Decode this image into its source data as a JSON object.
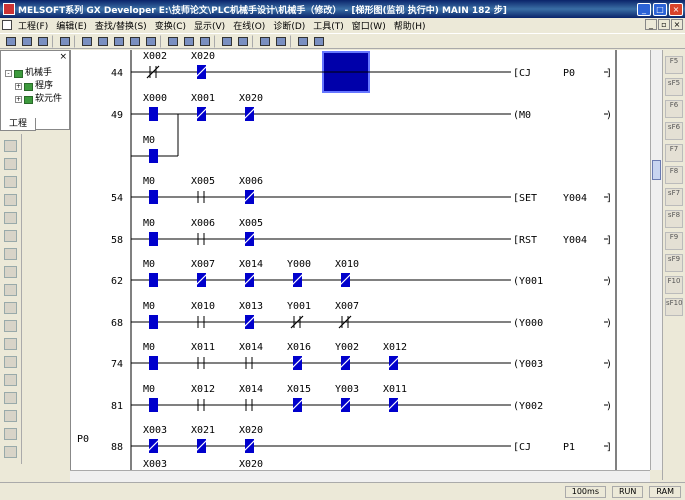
{
  "window": {
    "title": "MELSOFT系列 GX Developer E:\\技师论文\\PLC机械手设计\\机械手（修改） - [梯形图(监视 执行中)      MAIN    182 步]"
  },
  "menu": {
    "items": [
      "工程(F)",
      "编辑(E)",
      "查找/替换(S)",
      "变换(C)",
      "显示(V)",
      "在线(O)",
      "诊断(D)",
      "工具(T)",
      "窗口(W)",
      "帮助(H)"
    ]
  },
  "project_panel": {
    "root": "机械手",
    "children": [
      "程序",
      "软元件"
    ],
    "tab": "工程"
  },
  "ladder": {
    "rungs": [
      {
        "step": "44",
        "coil": "[CJ",
        "coil_arg": "P0",
        "contacts": [
          {
            "name": "X002",
            "type": "nc",
            "active": false
          },
          {
            "name": "X020",
            "type": "nc",
            "active": true
          }
        ]
      },
      {
        "step": "49",
        "coil": "(M0",
        "coil_arg": "",
        "contacts": [
          {
            "name": "X000",
            "type": "no",
            "active": true
          },
          {
            "name": "X001",
            "type": "nc",
            "active": true
          },
          {
            "name": "X020",
            "type": "nc",
            "active": true
          }
        ],
        "branch": {
          "name": "M0",
          "type": "no",
          "active": true
        }
      },
      {
        "step": "54",
        "coil": "[SET",
        "coil_arg": "Y004",
        "contacts": [
          {
            "name": "M0",
            "type": "no",
            "active": true
          },
          {
            "name": "X005",
            "type": "no",
            "active": false
          },
          {
            "name": "X006",
            "type": "nc",
            "active": true
          }
        ]
      },
      {
        "step": "58",
        "coil": "[RST",
        "coil_arg": "Y004",
        "contacts": [
          {
            "name": "M0",
            "type": "no",
            "active": true
          },
          {
            "name": "X006",
            "type": "no",
            "active": false
          },
          {
            "name": "X005",
            "type": "nc",
            "active": true
          }
        ]
      },
      {
        "step": "62",
        "coil": "(Y001",
        "coil_arg": "",
        "contacts": [
          {
            "name": "M0",
            "type": "no",
            "active": true
          },
          {
            "name": "X007",
            "type": "nc",
            "active": true
          },
          {
            "name": "X014",
            "type": "nc",
            "active": true
          },
          {
            "name": "Y000",
            "type": "nc",
            "active": true
          },
          {
            "name": "X010",
            "type": "nc",
            "active": true
          }
        ]
      },
      {
        "step": "68",
        "coil": "(Y000",
        "coil_arg": "",
        "contacts": [
          {
            "name": "M0",
            "type": "no",
            "active": true
          },
          {
            "name": "X010",
            "type": "no",
            "active": false
          },
          {
            "name": "X013",
            "type": "nc",
            "active": true
          },
          {
            "name": "Y001",
            "type": "nc",
            "active": false
          },
          {
            "name": "X007",
            "type": "nc",
            "active": false
          }
        ]
      },
      {
        "step": "74",
        "coil": "(Y003",
        "coil_arg": "",
        "contacts": [
          {
            "name": "M0",
            "type": "no",
            "active": true
          },
          {
            "name": "X011",
            "type": "no",
            "active": false
          },
          {
            "name": "X014",
            "type": "no",
            "active": false
          },
          {
            "name": "X016",
            "type": "nc",
            "active": true
          },
          {
            "name": "Y002",
            "type": "nc",
            "active": true
          },
          {
            "name": "X012",
            "type": "nc",
            "active": true
          }
        ]
      },
      {
        "step": "81",
        "coil": "(Y002",
        "coil_arg": "",
        "contacts": [
          {
            "name": "M0",
            "type": "no",
            "active": true
          },
          {
            "name": "X012",
            "type": "no",
            "active": false
          },
          {
            "name": "X014",
            "type": "no",
            "active": false
          },
          {
            "name": "X015",
            "type": "nc",
            "active": true
          },
          {
            "name": "Y003",
            "type": "nc",
            "active": true
          },
          {
            "name": "X011",
            "type": "nc",
            "active": true
          }
        ]
      },
      {
        "step": "88",
        "label": "P0",
        "coil": "[CJ",
        "coil_arg": "P1",
        "contacts": [
          {
            "name": "X003",
            "type": "nc",
            "active": true
          },
          {
            "name": "X021",
            "type": "nc",
            "active": true
          },
          {
            "name": "X020",
            "type": "nc",
            "active": true
          }
        ]
      },
      {
        "step": "",
        "coil": "",
        "coil_arg": "",
        "contacts": [
          {
            "name": "X003",
            "type": "none",
            "active": false
          },
          {
            "name": "",
            "type": "none",
            "active": false
          },
          {
            "name": "X020",
            "type": "none",
            "active": false
          }
        ]
      }
    ]
  },
  "right_toolbar": [
    "F5",
    "sF5",
    "F6",
    "sF6",
    "F7",
    "F8",
    "sF7",
    "sF8",
    "F9",
    "sF9",
    "F10",
    "sF10"
  ],
  "status": {
    "scan_time": "100ms",
    "state": "RUN",
    "mode": "RAM"
  },
  "colors": {
    "active_contact": "#0000CC",
    "rail": "#000000",
    "cursor_block": "#0000AA"
  }
}
